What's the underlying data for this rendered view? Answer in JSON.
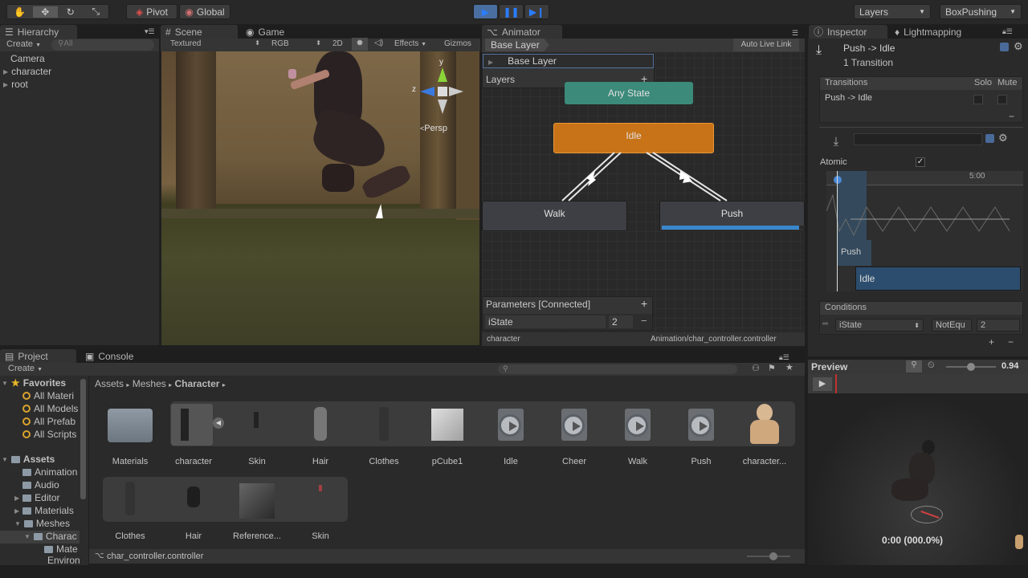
{
  "toolbar": {
    "pivot": "Pivot",
    "global": "Global",
    "layers": "Layers",
    "layout": "BoxPushing"
  },
  "hierarchy": {
    "tab": "Hierarchy",
    "create": "Create",
    "search_placeholder": "All",
    "items": [
      "Camera",
      "character",
      "root"
    ]
  },
  "scene": {
    "tab_scene": "Scene",
    "tab_game": "Game",
    "shading": "Textured",
    "rgb": "RGB",
    "mode2d": "2D",
    "effects": "Effects",
    "gizmos": "Gizmos",
    "persp": "Persp",
    "axis_y": "y",
    "axis_z": "z"
  },
  "animator": {
    "tab": "Animator",
    "breadcrumb": "Base Layer",
    "auto_live": "Auto Live Link",
    "layer_name": "Base Layer",
    "layers_label": "Layers",
    "states": {
      "any": "Any State",
      "idle": "Idle",
      "walk": "Walk",
      "push": "Push"
    },
    "params_title": "Parameters [Connected]",
    "param_name": "iState",
    "param_value": "2",
    "footer_left": "character",
    "footer_right": "Animation/char_controller.controller",
    "accent_idle": "#c87318",
    "accent_any": "#3b8a7a",
    "progress": 0.96
  },
  "inspector": {
    "tab": "Inspector",
    "tab2": "Lightmapping",
    "title": "Push -> Idle",
    "subtitle": "1 Transition",
    "transitions_label": "Transitions",
    "solo": "Solo",
    "mute": "Mute",
    "transition_item": "Push -> Idle",
    "atomic_label": "Atomic",
    "atomic_checked": true,
    "time_label": "5:00",
    "clip_push": "Push",
    "clip_idle": "Idle",
    "conditions_label": "Conditions",
    "cond_param": "iState",
    "cond_op": "NotEqu",
    "cond_val": "2"
  },
  "project": {
    "tab": "Project",
    "tab2": "Console",
    "create": "Create",
    "breadcrumb": [
      "Assets",
      "Meshes",
      "Character"
    ],
    "favorites_label": "Favorites",
    "favorites": [
      "All Materi",
      "All Models",
      "All Prefab",
      "All Scripts"
    ],
    "assets_label": "Assets",
    "asset_tree": [
      "Animation",
      "Audio",
      "Editor",
      "Materials",
      "Meshes",
      "Charac",
      "Mate",
      "Environ"
    ],
    "row1": [
      "Materials",
      "character",
      "Skin",
      "Hair",
      "Clothes",
      "pCube1",
      "Idle",
      "Cheer",
      "Walk",
      "Push",
      "character..."
    ],
    "row2": [
      "Clothes",
      "Hair",
      "Reference...",
      "Skin"
    ],
    "status_file": "char_controller.controller"
  },
  "preview": {
    "title": "Preview",
    "speed": "0.94",
    "time": "0:00 (000.0%)"
  }
}
